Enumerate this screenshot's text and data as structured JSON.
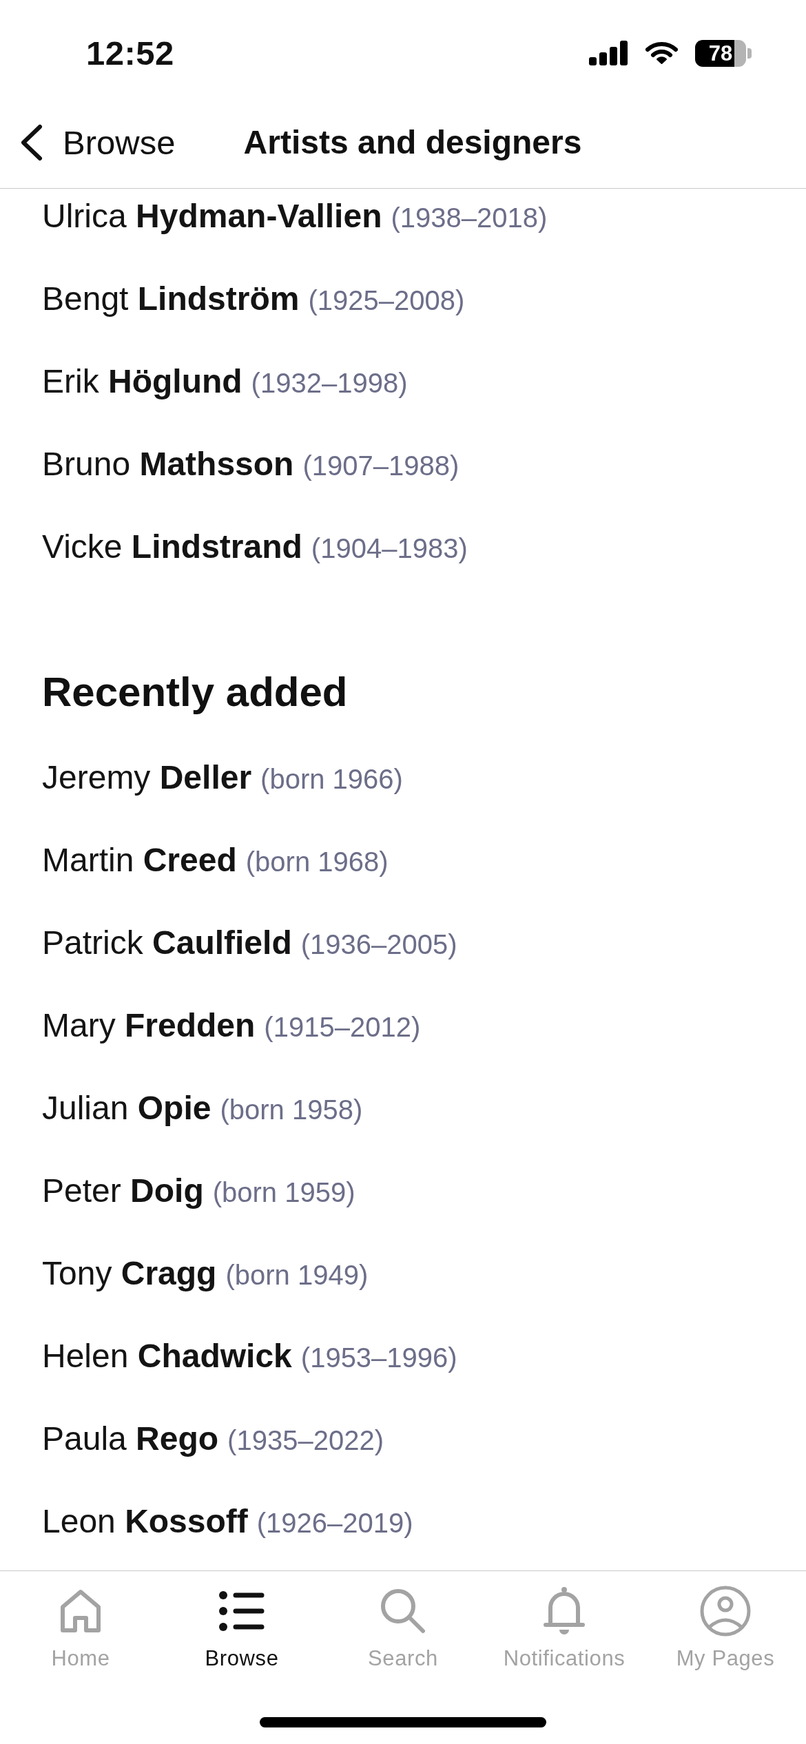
{
  "status_bar": {
    "time": "12:52",
    "battery": "78"
  },
  "nav_bar": {
    "back_label": "Browse",
    "title": "Artists and designers"
  },
  "sections": [
    {
      "items": [
        {
          "name": "Ulrica **Hydman-Vallien**",
          "dates": "(1938–2018)"
        },
        {
          "name": "Bengt **Lindström**",
          "dates": "(1925–2008)"
        },
        {
          "name": "Erik **Höglund**",
          "dates": "(1932–1998)"
        },
        {
          "name": "Bruno **Mathsson**",
          "dates": "(1907–1988)"
        },
        {
          "name": "Vicke **Lindstrand**",
          "dates": "(1904–1983)"
        }
      ]
    },
    {
      "heading": "Recently added",
      "items": [
        {
          "name": "Jeremy **Deller**",
          "dates": "(born 1966)"
        },
        {
          "name": "Martin **Creed**",
          "dates": "(born 1968)"
        },
        {
          "name": "Patrick **Caulfield**",
          "dates": "(1936–2005)"
        },
        {
          "name": "Mary **Fredden**",
          "dates": "(1915–2012)"
        },
        {
          "name": "Julian **Opie**",
          "dates": "(born 1958)"
        },
        {
          "name": "Peter **Doig**",
          "dates": "(born 1959)"
        },
        {
          "name": "Tony **Cragg**",
          "dates": "(born 1949)"
        },
        {
          "name": "Helen **Chadwick**",
          "dates": "(1953–1996)"
        },
        {
          "name": "Paula **Rego**",
          "dates": "(1935–2022)"
        },
        {
          "name": "Leon **Kossoff**",
          "dates": "(1926–2019)"
        }
      ]
    }
  ],
  "tab_bar": [
    {
      "label": "Home",
      "selected": false
    },
    {
      "label": "Browse",
      "selected": true
    },
    {
      "label": "Search",
      "selected": false
    },
    {
      "label": "Notifications",
      "selected": false
    },
    {
      "label": "My Pages",
      "selected": false
    }
  ]
}
